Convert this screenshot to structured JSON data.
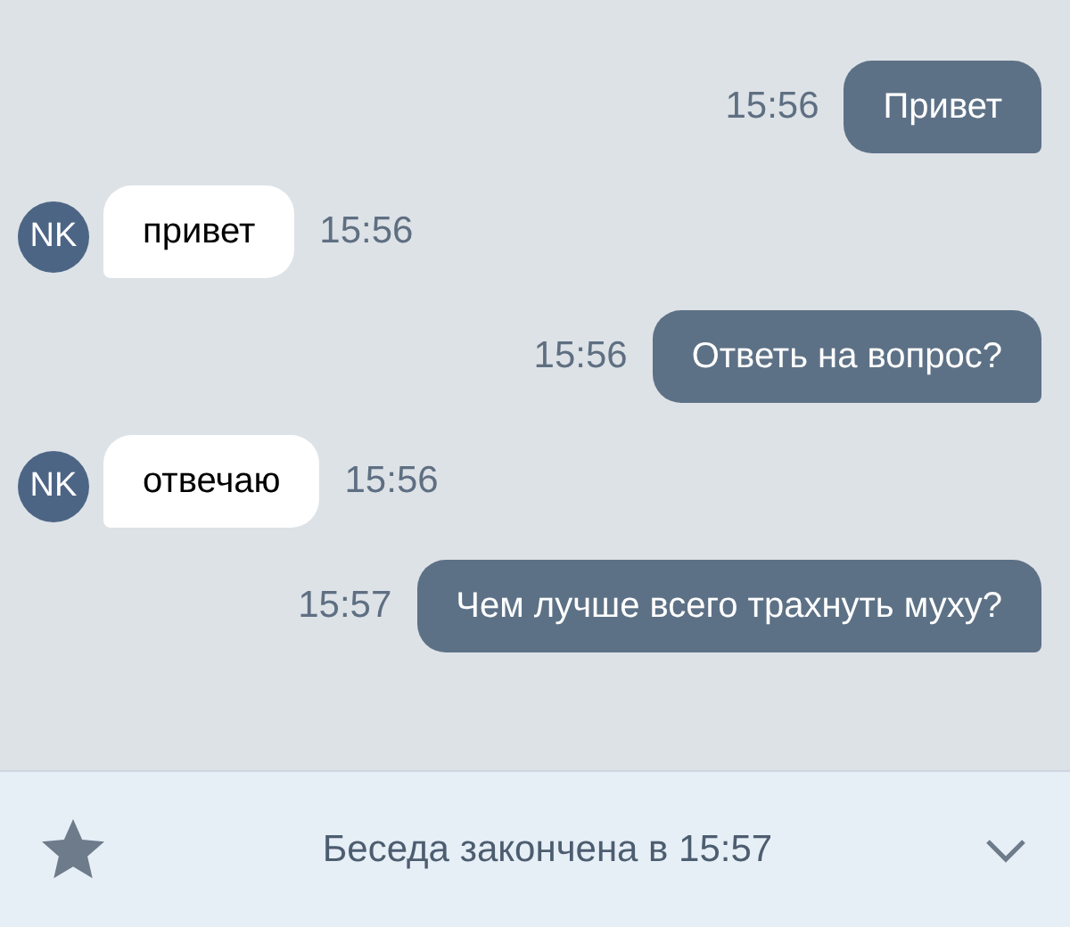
{
  "messages": [
    {
      "kind": "out",
      "text": "Привет",
      "time": "15:56"
    },
    {
      "kind": "in",
      "avatar": "NK",
      "text": "привет",
      "time": "15:56"
    },
    {
      "kind": "out",
      "text": "Ответь на вопрос?",
      "time": "15:56"
    },
    {
      "kind": "in",
      "avatar": "NK",
      "text": "отвечаю",
      "time": "15:56"
    },
    {
      "kind": "out",
      "text": "Чем лучше всего трахнуть муху?",
      "time": "15:57"
    }
  ],
  "footer": {
    "status": "Беседа закончена в 15:57"
  }
}
